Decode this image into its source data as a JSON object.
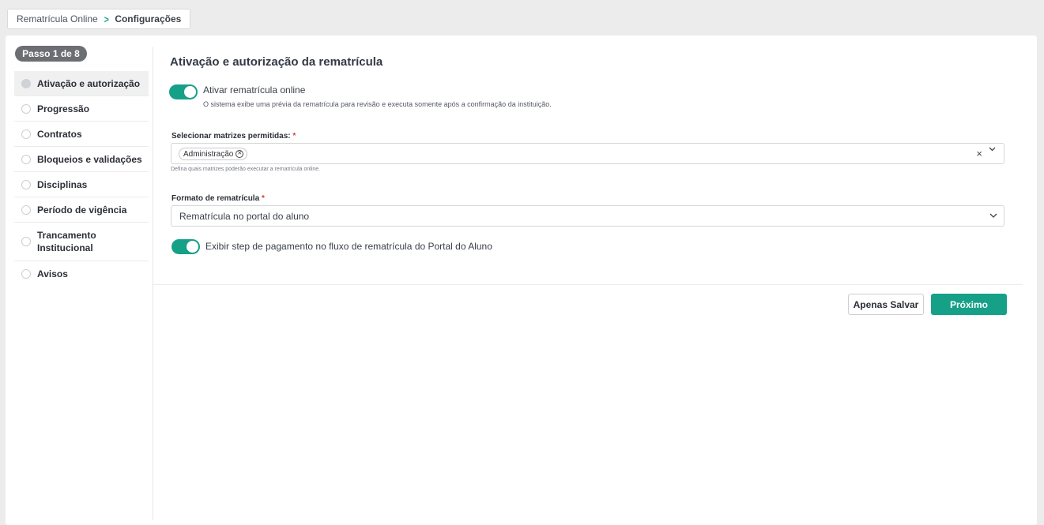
{
  "breadcrumb": {
    "parent": "Rematrícula Online",
    "current": "Configurações"
  },
  "sidebar": {
    "step_badge": "Passo 1 de 8",
    "items": [
      {
        "label": "Ativação e autorização"
      },
      {
        "label": "Progressão"
      },
      {
        "label": "Contratos"
      },
      {
        "label": "Bloqueios e validações"
      },
      {
        "label": "Disciplinas"
      },
      {
        "label": "Período de vigência"
      },
      {
        "label": "Trancamento Institucional"
      },
      {
        "label": "Avisos"
      }
    ]
  },
  "main": {
    "title": "Ativação e autorização da rematrícula",
    "activate_toggle": {
      "label": "Ativar rematrícula online",
      "description": "O sistema exibe uma prévia da rematrícula para revisão e executa somente após a confirmação da instituição.",
      "checked": true
    },
    "matrices": {
      "label": "Selecionar matrizes permitidas:",
      "required_mark": "*",
      "chips": [
        "Administração"
      ],
      "hint": "Defina quais matrizes poderão executar a rematrícula online."
    },
    "format": {
      "label": "Formato de rematrícula",
      "required_mark": "*",
      "value": "Rematrícula no portal do aluno"
    },
    "payment_toggle": {
      "label": "Exibir step de pagamento no fluxo de rematrícula do Portal do Aluno",
      "checked": true
    }
  },
  "actions": {
    "save_label": "Apenas Salvar",
    "next_label": "Próximo"
  },
  "colors": {
    "accent": "#16a087",
    "required": "#d63a3a",
    "badge": "#6b6e73"
  }
}
